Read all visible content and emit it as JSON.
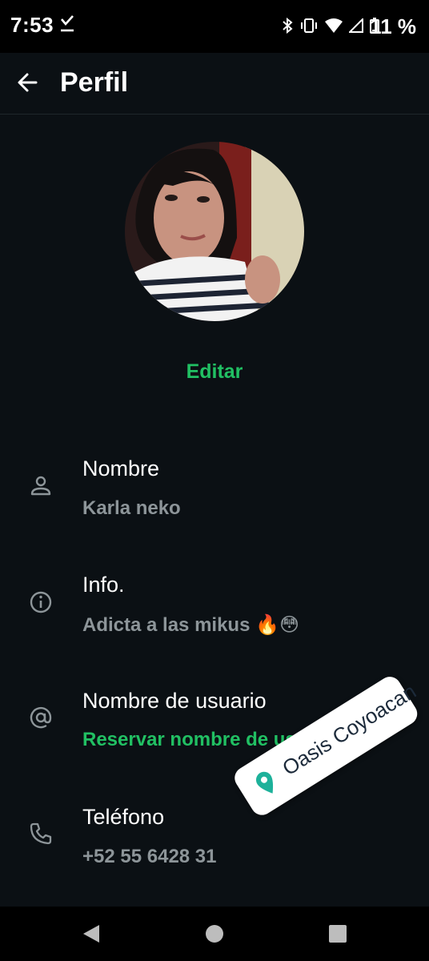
{
  "status_bar": {
    "time": "7:53",
    "battery": "11 %",
    "icons": [
      "download-done-icon",
      "bluetooth-icon",
      "vibrate-icon",
      "wifi-icon",
      "signal-icon",
      "battery-icon"
    ]
  },
  "header": {
    "back_icon": "arrow-back-icon",
    "title": "Perfil"
  },
  "profile": {
    "edit_label": "Editar"
  },
  "rows": [
    {
      "icon": "person-icon",
      "label": "Nombre",
      "value": "Karla neko"
    },
    {
      "icon": "info-icon",
      "label": "Info.",
      "value": "Adicta a las mikus 🔥😳"
    },
    {
      "icon": "at-icon",
      "label": "Nombre de usuario",
      "value": "Reservar nombre de usuario"
    },
    {
      "icon": "phone-icon",
      "label": "Teléfono",
      "value": "+52 55 6428 31"
    }
  ],
  "location_sticker": {
    "text": "Oasis Coyoacan",
    "icon": "location-pin-icon"
  },
  "nav_bar": {
    "icons": [
      "back-triangle-icon",
      "home-circle-icon",
      "recents-square-icon"
    ]
  },
  "colors": {
    "background": "#0b1014",
    "accent": "#21c063",
    "secondary_text": "#8d9599"
  }
}
